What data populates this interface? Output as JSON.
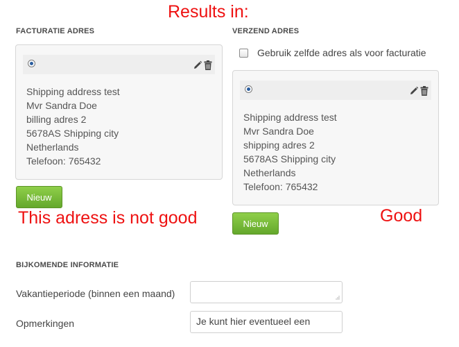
{
  "annotations": {
    "top": "Results in:",
    "bad": "This adress is not good",
    "good": "Good"
  },
  "billing": {
    "title": "FACTURATIE ADRES",
    "address_lines": [
      "Shipping address test",
      "Mvr Sandra Doe",
      "billing adres 2",
      "5678AS Shipping city",
      "Netherlands",
      "Telefoon: 765432"
    ],
    "new_button": "Nieuw"
  },
  "shipping": {
    "title": "VERZEND ADRES",
    "same_as_billing_label": "Gebruik zelfde adres als voor facturatie",
    "same_as_billing_checked": false,
    "address_lines": [
      "Shipping address test",
      "Mvr Sandra Doe",
      "shipping adres 2",
      "5678AS Shipping city",
      "Netherlands",
      "Telefoon: 765432"
    ],
    "new_button": "Nieuw"
  },
  "extra": {
    "title": "BIJKOMENDE INFORMATIE",
    "vacation_label": "Vakantieperiode (binnen een maand)",
    "vacation_value": "",
    "remarks_label": "Opmerkingen",
    "remarks_value": "Je kunt hier eventueel een"
  },
  "icons": {
    "radio": "radio-selected-icon",
    "edit": "pencil-icon",
    "delete": "trash-icon"
  },
  "colors": {
    "annotation": "#ee1111",
    "button_green": "#74b837",
    "radio_dot": "#2a5d9f"
  }
}
